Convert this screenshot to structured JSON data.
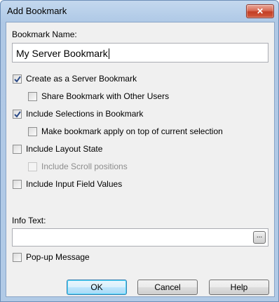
{
  "window": {
    "title": "Add Bookmark",
    "close_glyph": "✕"
  },
  "bookmark_name": {
    "label": "Bookmark Name:",
    "value": "My Server Bookmark"
  },
  "options": {
    "create_server": {
      "label": "Create as a Server Bookmark",
      "checked": true
    },
    "share_users": {
      "label": "Share Bookmark with Other Users",
      "checked": false
    },
    "include_selections": {
      "label": "Include Selections in Bookmark",
      "checked": true
    },
    "apply_on_top": {
      "label": "Make bookmark apply on top of current selection",
      "checked": false
    },
    "include_layout": {
      "label": "Include Layout State",
      "checked": false
    },
    "include_scroll": {
      "label": "Include Scroll positions",
      "checked": false,
      "disabled": true
    },
    "include_input": {
      "label": "Include Input Field Values",
      "checked": false
    }
  },
  "info_text": {
    "label": "Info Text:",
    "value": "",
    "browse_label": "..."
  },
  "popup": {
    "label": "Pop-up Message",
    "checked": false
  },
  "buttons": {
    "ok": "OK",
    "cancel": "Cancel",
    "help": "Help"
  }
}
